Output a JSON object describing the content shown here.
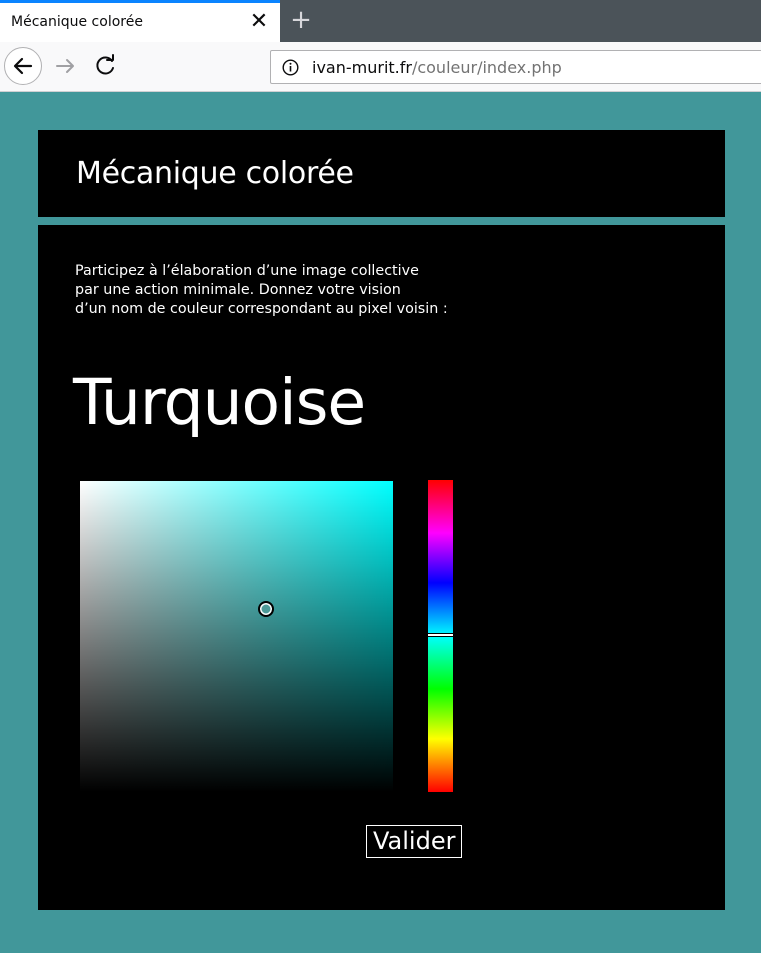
{
  "browser": {
    "tab_title": "Mécanique colorée",
    "tab_close": "✕",
    "new_tab": "+",
    "url_host": "ivan-murit.fr",
    "url_path": "/couleur/index.php",
    "accent_color": "#0a84ff"
  },
  "page": {
    "background_color": "#41979a",
    "site_title": "Mécanique colorée",
    "intro_lines": [
      "Participez à l’élaboration d’une image collective",
      "par une action minimale. Donnez votre vision",
      "d’un nom de couleur correspondant au pixel voisin :"
    ],
    "color_name": "Turquoise",
    "picker": {
      "hue_color": "#00ffff",
      "selected_color": "#4d9a98"
    },
    "submit_label": "Valider"
  }
}
